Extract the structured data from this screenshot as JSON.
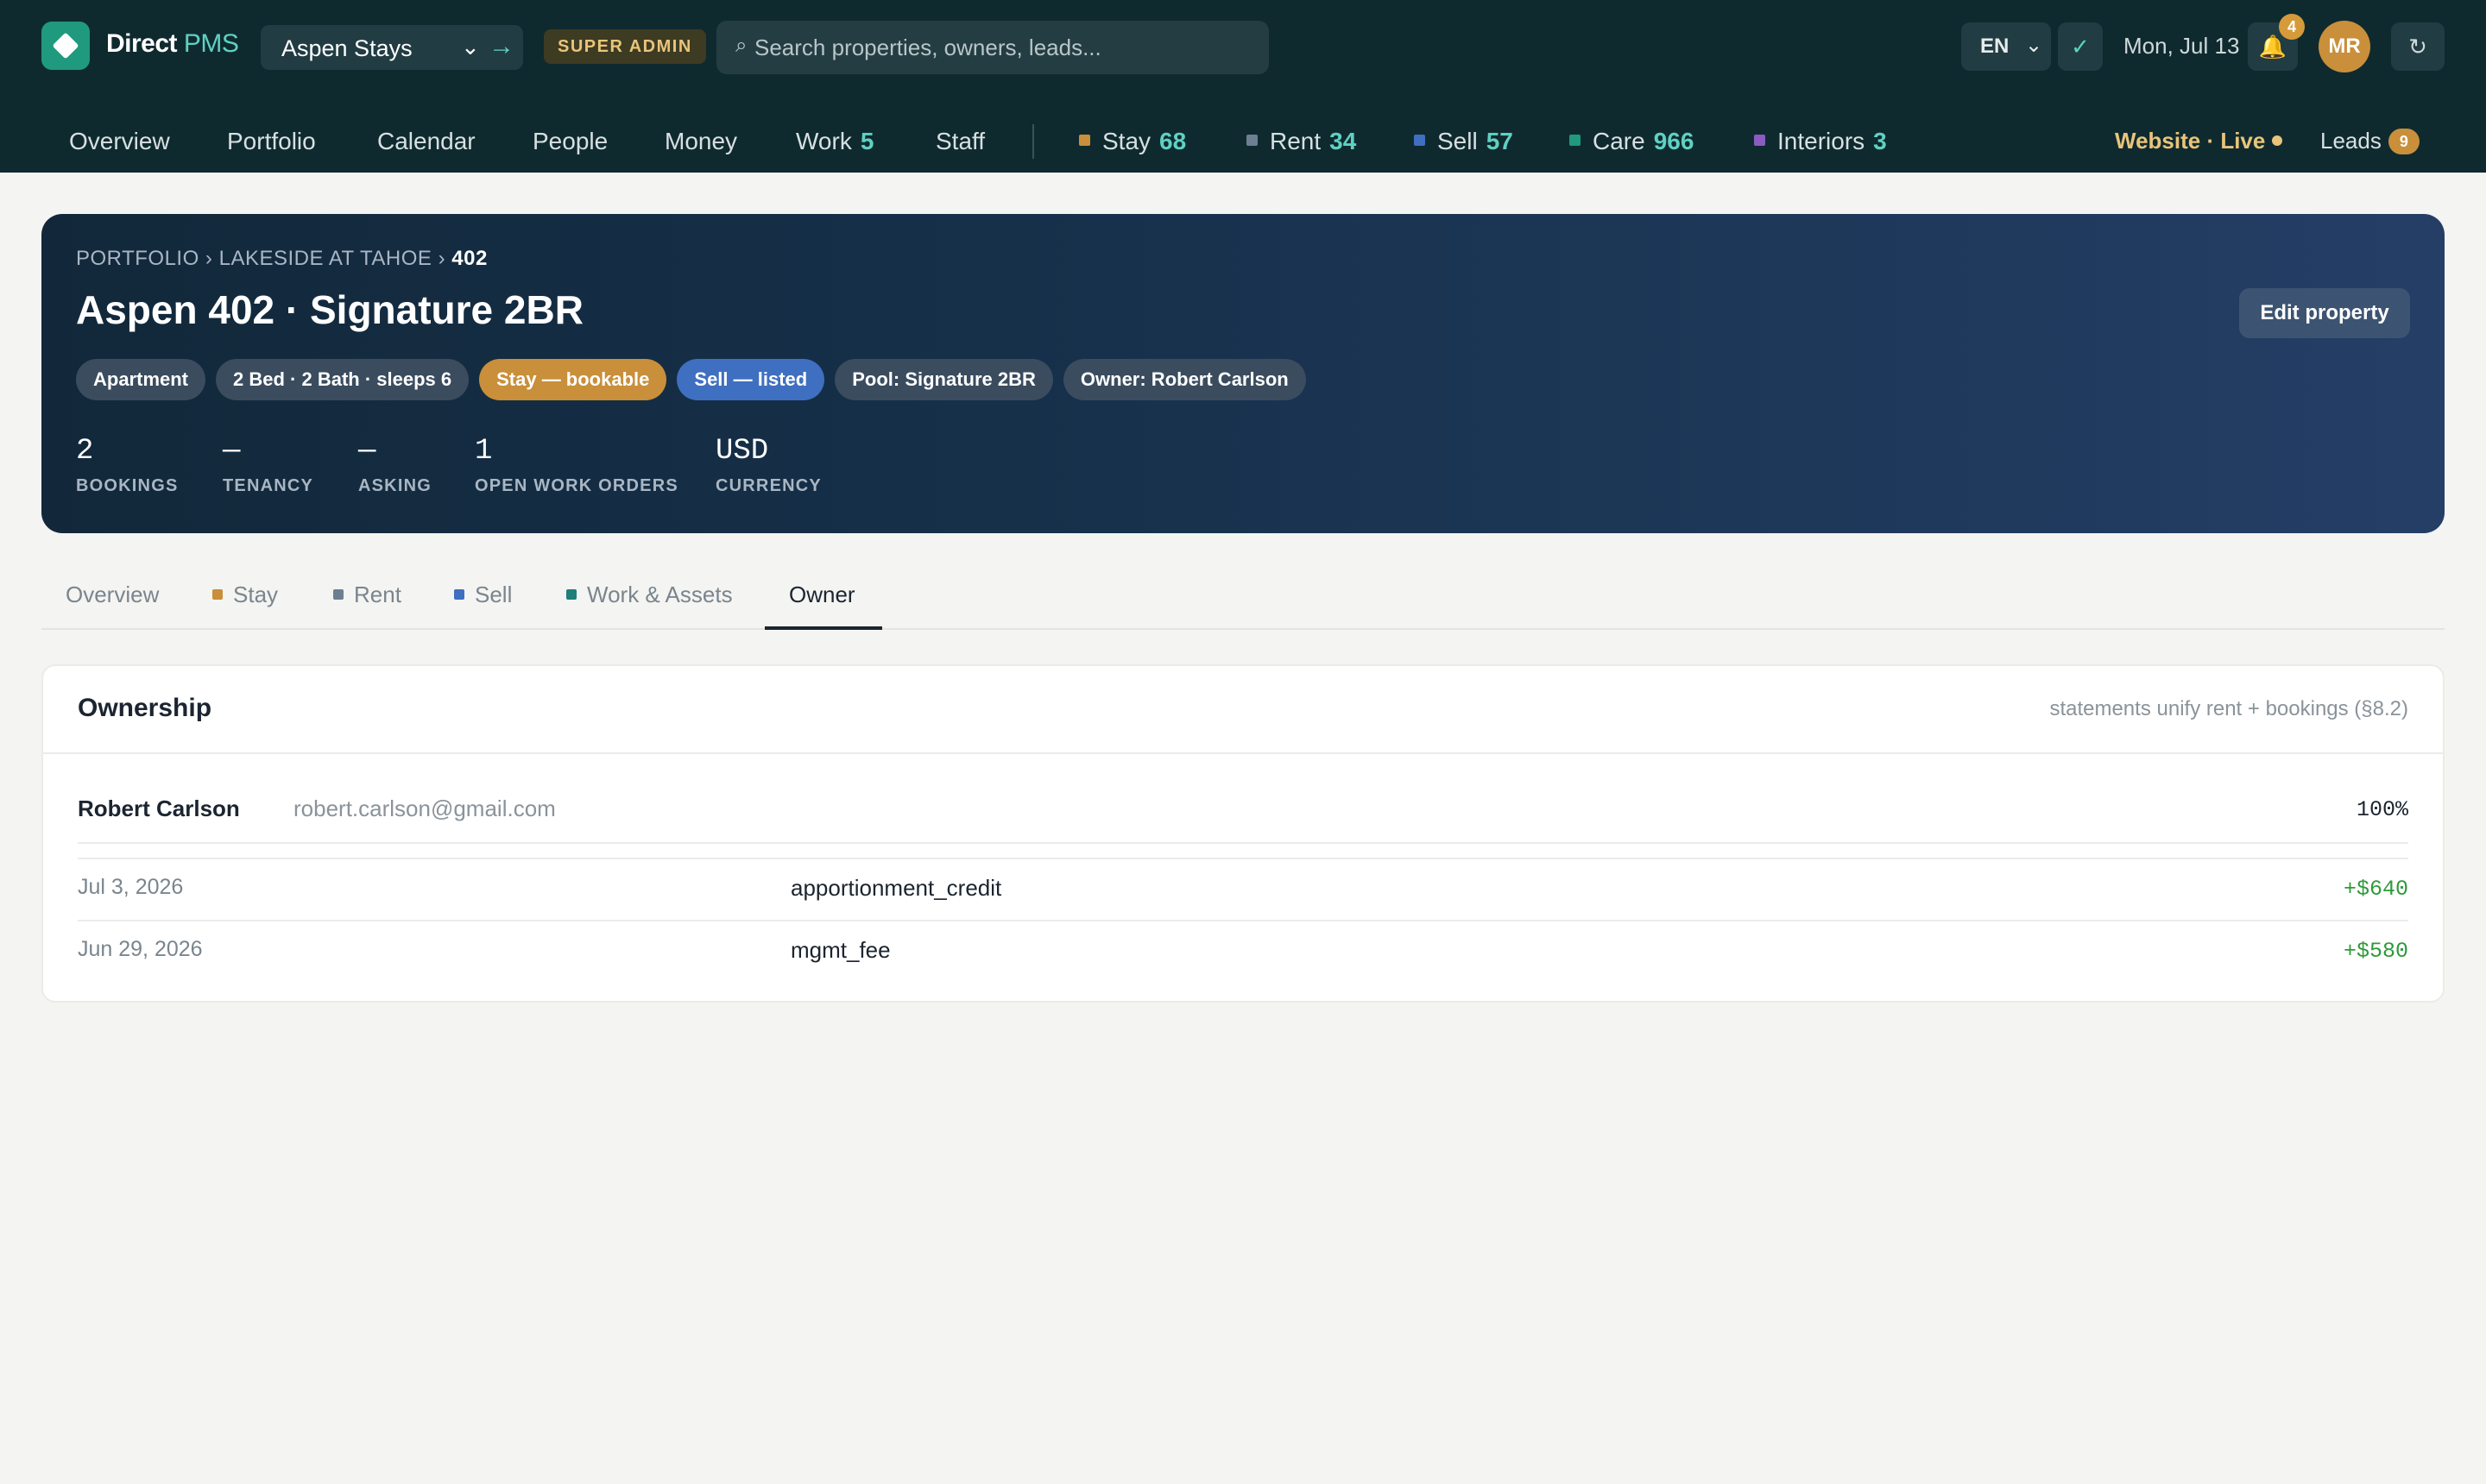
{
  "app": {
    "brand_main": "Direct",
    "brand_accent": "PMS",
    "property_selector": "Aspen Stays",
    "role_badge": "SUPER ADMIN",
    "search_placeholder": "Search properties, owners, leads...",
    "language": "EN",
    "date": "Mon, Jul 13",
    "notifications_count": "4",
    "user_initials": "MR"
  },
  "nav": {
    "items": [
      {
        "label": "Overview"
      },
      {
        "label": "Portfolio"
      },
      {
        "label": "Calendar"
      },
      {
        "label": "People"
      },
      {
        "label": "Money"
      },
      {
        "label": "Work",
        "count": "5"
      },
      {
        "label": "Staff"
      }
    ],
    "modules": [
      {
        "label": "Stay",
        "count": "68",
        "color": "#c98f3a"
      },
      {
        "label": "Rent",
        "count": "34",
        "color": "#6d7f92"
      },
      {
        "label": "Sell",
        "count": "57",
        "color": "#3f6fc0"
      },
      {
        "label": "Care",
        "count": "966",
        "color": "#1f9a7e"
      },
      {
        "label": "Interiors",
        "count": "3",
        "color": "#8a5cc0"
      }
    ],
    "website_status": "Website · Live",
    "leads_label": "Leads",
    "leads_count": "9"
  },
  "property": {
    "breadcrumb": [
      "PORTFOLIO",
      "LAKESIDE AT TAHOE",
      "402"
    ],
    "title": "Aspen 402 · Signature 2BR",
    "edit_label": "Edit property",
    "chips": [
      {
        "label": "Apartment",
        "kind": "default"
      },
      {
        "label": "2 Bed · 2 Bath · sleeps 6",
        "kind": "default"
      },
      {
        "label": "Stay — bookable",
        "kind": "stay"
      },
      {
        "label": "Sell — listed",
        "kind": "sell"
      },
      {
        "label": "Pool: Signature 2BR",
        "kind": "default"
      },
      {
        "label": "Owner: Robert Carlson",
        "kind": "default"
      }
    ],
    "stats": [
      {
        "value": "2",
        "label": "BOOKINGS"
      },
      {
        "value": "—",
        "label": "TENANCY"
      },
      {
        "value": "—",
        "label": "ASKING"
      },
      {
        "value": "1",
        "label": "OPEN WORK ORDERS"
      },
      {
        "value": "USD",
        "label": "CURRENCY"
      }
    ]
  },
  "tabs": [
    {
      "label": "Overview"
    },
    {
      "label": "Stay",
      "color": "#c98f3a"
    },
    {
      "label": "Rent",
      "color": "#6d7f92"
    },
    {
      "label": "Sell",
      "color": "#3f6fc0"
    },
    {
      "label": "Work & Assets",
      "color": "#1f7f7a"
    },
    {
      "label": "Owner",
      "active": true
    }
  ],
  "ownership": {
    "title": "Ownership",
    "note": "statements unify rent + bookings (§8.2)",
    "owner": {
      "name": "Robert Carlson",
      "email": "robert.carlson@gmail.com",
      "share": "100%"
    },
    "transactions": [
      {
        "date": "Jul 3, 2026",
        "type": "apportionment_credit",
        "amount": "+$640"
      },
      {
        "date": "Jun 29, 2026",
        "type": "mgmt_fee",
        "amount": "+$580"
      }
    ]
  }
}
